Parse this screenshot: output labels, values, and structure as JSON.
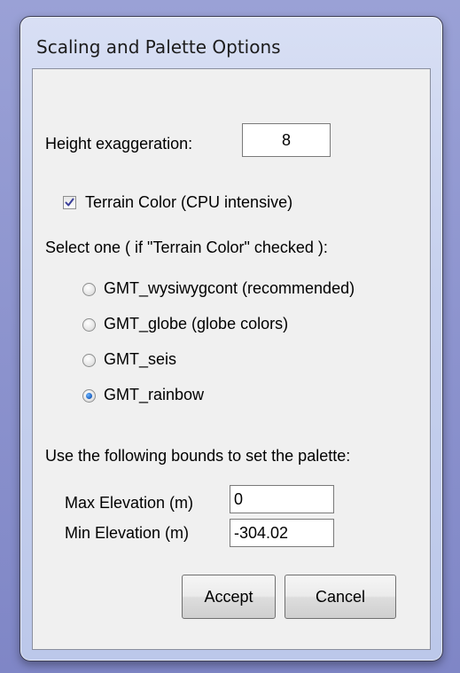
{
  "window": {
    "title": "Scaling and Palette Options"
  },
  "height": {
    "label": "Height exaggeration:",
    "value": "8"
  },
  "terrain": {
    "label": "Terrain Color (CPU intensive)",
    "checked": true
  },
  "palette": {
    "prompt": "Select one ( if \"Terrain Color\" checked ):",
    "options": [
      {
        "label": "GMT_wysiwygcont (recommended)",
        "checked": false
      },
      {
        "label": "GMT_globe (globe colors)",
        "checked": false
      },
      {
        "label": "GMT_seis",
        "checked": false
      },
      {
        "label": "GMT_rainbow",
        "checked": true
      }
    ]
  },
  "bounds": {
    "prompt": "Use the following bounds to set the palette:",
    "max_label": "Max Elevation (m)",
    "max_value": "0",
    "min_label": "Min Elevation (m)",
    "min_value": "-304.02"
  },
  "buttons": {
    "accept": "Accept",
    "cancel": "Cancel"
  }
}
